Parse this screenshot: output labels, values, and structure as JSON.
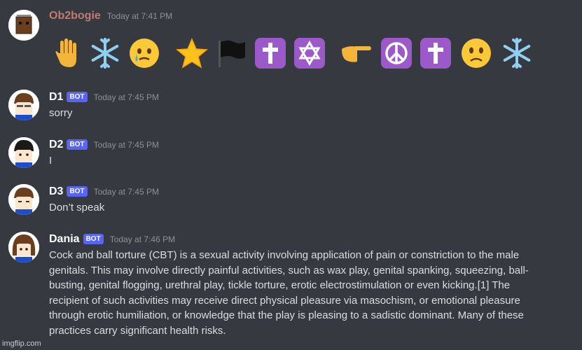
{
  "messages": [
    {
      "username": "Ob2bogie",
      "timestamp": "Today at 7:41 PM",
      "avatar_icon": "brown-square-avatar-icon",
      "emojis": [
        "raised-hand-icon",
        "snowflake-icon",
        "face-holding-back-tears-icon",
        "star-icon",
        "black-flag-icon",
        "latin-cross-icon",
        "star-of-david-icon",
        "pointing-right-icon",
        "peace-symbol-icon",
        "latin-cross-icon",
        "slightly-frowning-face-icon",
        "snowflake-icon"
      ]
    },
    {
      "username": "D1",
      "badge": "BOT",
      "timestamp": "Today at 7:45 PM",
      "text": "sorry"
    },
    {
      "username": "D2",
      "badge": "BOT",
      "timestamp": "Today at 7:45 PM",
      "text": "I"
    },
    {
      "username": "D3",
      "badge": "BOT",
      "timestamp": "Today at 7:45 PM",
      "text": "Don’t speak"
    },
    {
      "username": "Dania",
      "badge": "BOT",
      "timestamp": "Today at 7:46 PM",
      "lines": [
        "Cock and ball torture (CBT) is a sexual activity involving application of pain or constriction to the male",
        "genitals. This may involve directly painful activities, such as wax play, genital spanking, squeezing, ball-",
        "busting, genital flogging, urethral play, tickle torture, erotic electrostimulation or even kicking.[1] The",
        "recipient of such activities may receive direct physical pleasure via masochism, or emotional pleasure",
        "through erotic humiliation, or knowledge that the play is pleasing to a sadistic dominant. Many of these",
        "practices carry significant health risks."
      ]
    }
  ],
  "watermark": "imgflip.com",
  "colors": {
    "background": "#36393f",
    "bot_badge": "#5865f2",
    "first_username": "#c27c6f",
    "timestamp": "#8e9297"
  }
}
